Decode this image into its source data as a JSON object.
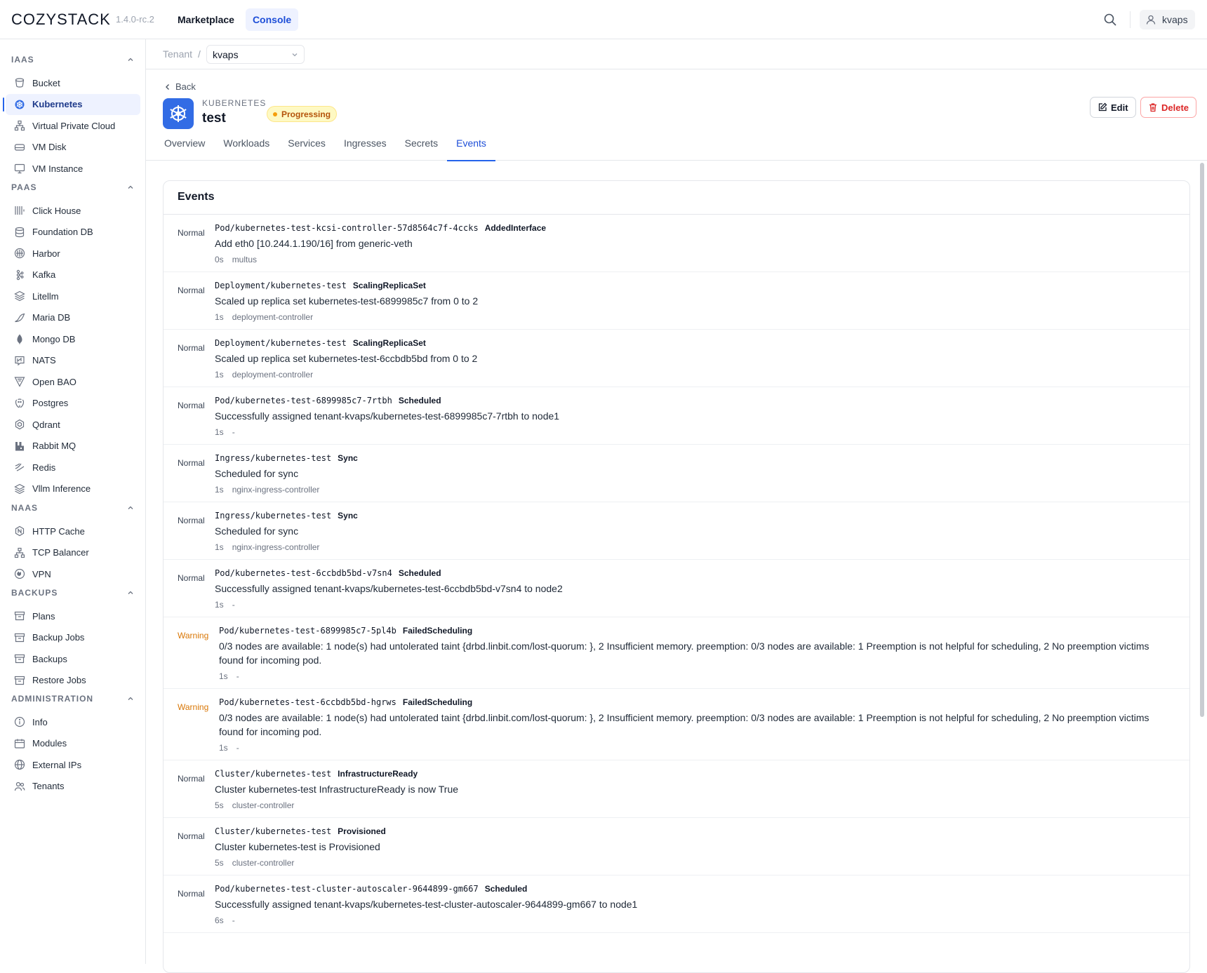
{
  "brand": {
    "name": "COZYSTACK",
    "version": "1.4.0-rc.2"
  },
  "topnav": [
    {
      "label": "Marketplace",
      "active": false
    },
    {
      "label": "Console",
      "active": true
    }
  ],
  "user": {
    "name": "kvaps"
  },
  "sidebar": {
    "sections": [
      {
        "title": "IAAS",
        "items": [
          {
            "label": "Bucket",
            "icon": "bucket-icon"
          },
          {
            "label": "Kubernetes",
            "icon": "kubernetes-icon",
            "active": true
          },
          {
            "label": "Virtual Private Cloud",
            "icon": "network-icon"
          },
          {
            "label": "VM Disk",
            "icon": "disk-icon"
          },
          {
            "label": "VM Instance",
            "icon": "monitor-icon"
          }
        ]
      },
      {
        "title": "PAAS",
        "items": [
          {
            "label": "Click House",
            "icon": "clickhouse-icon"
          },
          {
            "label": "Foundation DB",
            "icon": "database-icon"
          },
          {
            "label": "Harbor",
            "icon": "harbor-icon"
          },
          {
            "label": "Kafka",
            "icon": "kafka-icon"
          },
          {
            "label": "Litellm",
            "icon": "layers-icon"
          },
          {
            "label": "Maria DB",
            "icon": "mariadb-icon"
          },
          {
            "label": "Mongo DB",
            "icon": "mongodb-icon"
          },
          {
            "label": "NATS",
            "icon": "nats-icon"
          },
          {
            "label": "Open BAO",
            "icon": "openbao-icon"
          },
          {
            "label": "Postgres",
            "icon": "postgres-icon"
          },
          {
            "label": "Qdrant",
            "icon": "qdrant-icon"
          },
          {
            "label": "Rabbit MQ",
            "icon": "rabbitmq-icon"
          },
          {
            "label": "Redis",
            "icon": "redis-icon"
          },
          {
            "label": "Vllm Inference",
            "icon": "layers-icon"
          }
        ]
      },
      {
        "title": "NAAS",
        "items": [
          {
            "label": "HTTP Cache",
            "icon": "nginx-icon"
          },
          {
            "label": "TCP Balancer",
            "icon": "network-icon"
          },
          {
            "label": "VPN",
            "icon": "vpn-icon"
          }
        ]
      },
      {
        "title": "BACKUPS",
        "items": [
          {
            "label": "Plans",
            "icon": "archive-icon"
          },
          {
            "label": "Backup Jobs",
            "icon": "archive-icon"
          },
          {
            "label": "Backups",
            "icon": "archive-icon"
          },
          {
            "label": "Restore Jobs",
            "icon": "archive-icon"
          }
        ]
      },
      {
        "title": "ADMINISTRATION",
        "items": [
          {
            "label": "Info",
            "icon": "info-icon"
          },
          {
            "label": "Modules",
            "icon": "calendar-icon"
          },
          {
            "label": "External IPs",
            "icon": "globe-icon"
          },
          {
            "label": "Tenants",
            "icon": "users-icon"
          }
        ]
      }
    ]
  },
  "breadcrumb": {
    "root": "Tenant",
    "separator": "/",
    "tenant": "kvaps"
  },
  "resource": {
    "back_label": "Back",
    "kind": "KUBERNETES",
    "name": "test",
    "status": "Progressing",
    "edit_label": "Edit",
    "delete_label": "Delete",
    "colors": {
      "accent": "#2563eb",
      "status": "#b45309",
      "danger": "#dc2626",
      "kube": "#326ce5"
    }
  },
  "tabs": [
    {
      "label": "Overview"
    },
    {
      "label": "Workloads"
    },
    {
      "label": "Services"
    },
    {
      "label": "Ingresses"
    },
    {
      "label": "Secrets"
    },
    {
      "label": "Events",
      "active": true
    }
  ],
  "events": {
    "title": "Events",
    "items": [
      {
        "type": "Normal",
        "object": "Pod/kubernetes-test-kcsi-controller-57d8564c7f-4ccks",
        "reason": "AddedInterface",
        "message": "Add eth0 [10.244.1.190/16] from generic-veth",
        "age": "0s",
        "source": "multus"
      },
      {
        "type": "Normal",
        "object": "Deployment/kubernetes-test",
        "reason": "ScalingReplicaSet",
        "message": "Scaled up replica set kubernetes-test-6899985c7 from 0 to 2",
        "age": "1s",
        "source": "deployment-controller"
      },
      {
        "type": "Normal",
        "object": "Deployment/kubernetes-test",
        "reason": "ScalingReplicaSet",
        "message": "Scaled up replica set kubernetes-test-6ccbdb5bd from 0 to 2",
        "age": "1s",
        "source": "deployment-controller"
      },
      {
        "type": "Normal",
        "object": "Pod/kubernetes-test-6899985c7-7rtbh",
        "reason": "Scheduled",
        "message": "Successfully assigned tenant-kvaps/kubernetes-test-6899985c7-7rtbh to node1",
        "age": "1s",
        "source": "-"
      },
      {
        "type": "Normal",
        "object": "Ingress/kubernetes-test",
        "reason": "Sync",
        "message": "Scheduled for sync",
        "age": "1s",
        "source": "nginx-ingress-controller"
      },
      {
        "type": "Normal",
        "object": "Ingress/kubernetes-test",
        "reason": "Sync",
        "message": "Scheduled for sync",
        "age": "1s",
        "source": "nginx-ingress-controller"
      },
      {
        "type": "Normal",
        "object": "Pod/kubernetes-test-6ccbdb5bd-v7sn4",
        "reason": "Scheduled",
        "message": "Successfully assigned tenant-kvaps/kubernetes-test-6ccbdb5bd-v7sn4 to node2",
        "age": "1s",
        "source": "-"
      },
      {
        "type": "Warning",
        "object": "Pod/kubernetes-test-6899985c7-5pl4b",
        "reason": "FailedScheduling",
        "message": "0/3 nodes are available: 1 node(s) had untolerated taint {drbd.linbit.com/lost-quorum: }, 2 Insufficient memory. preemption: 0/3 nodes are available: 1 Preemption is not helpful for scheduling, 2 No preemption victims found for incoming pod.",
        "age": "1s",
        "source": "-"
      },
      {
        "type": "Warning",
        "object": "Pod/kubernetes-test-6ccbdb5bd-hgrws",
        "reason": "FailedScheduling",
        "message": "0/3 nodes are available: 1 node(s) had untolerated taint {drbd.linbit.com/lost-quorum: }, 2 Insufficient memory. preemption: 0/3 nodes are available: 1 Preemption is not helpful for scheduling, 2 No preemption victims found for incoming pod.",
        "age": "1s",
        "source": "-"
      },
      {
        "type": "Normal",
        "object": "Cluster/kubernetes-test",
        "reason": "InfrastructureReady",
        "message": "Cluster kubernetes-test InfrastructureReady is now True",
        "age": "5s",
        "source": "cluster-controller"
      },
      {
        "type": "Normal",
        "object": "Cluster/kubernetes-test",
        "reason": "Provisioned",
        "message": "Cluster kubernetes-test is Provisioned",
        "age": "5s",
        "source": "cluster-controller"
      },
      {
        "type": "Normal",
        "object": "Pod/kubernetes-test-cluster-autoscaler-9644899-gm667",
        "reason": "Scheduled",
        "message": "Successfully assigned tenant-kvaps/kubernetes-test-cluster-autoscaler-9644899-gm667 to node1",
        "age": "6s",
        "source": "-"
      }
    ]
  }
}
